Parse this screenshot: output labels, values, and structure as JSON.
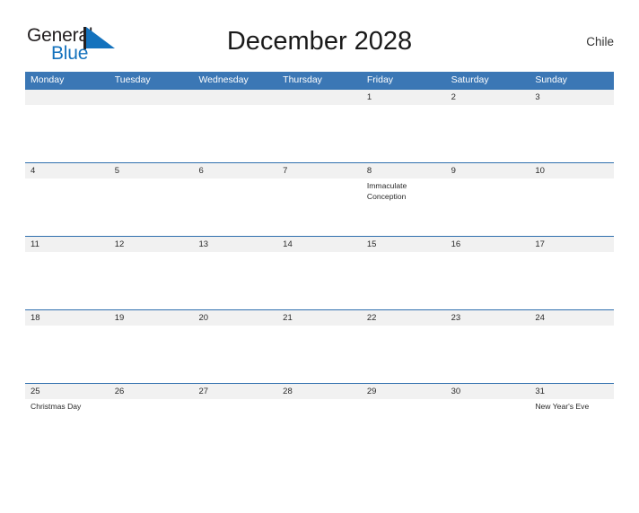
{
  "logo": {
    "text_primary": "General",
    "text_secondary": "Blue",
    "flag_icon": "triangle-flag-icon",
    "color_primary": "#231f20",
    "color_secondary": "#1472bd"
  },
  "header": {
    "title": "December 2028",
    "country": "Chile"
  },
  "theme": {
    "header_blue": "#3b77b5",
    "date_band_gray": "#f1f1f1",
    "rule_blue": "#2f6fae",
    "text_dark": "#2a2a2a",
    "background": "#ffffff"
  },
  "calendar": {
    "weekdays": [
      "Monday",
      "Tuesday",
      "Wednesday",
      "Thursday",
      "Friday",
      "Saturday",
      "Sunday"
    ],
    "weeks": [
      {
        "dates": [
          "",
          "",
          "",
          "",
          "1",
          "2",
          "3"
        ],
        "events": [
          "",
          "",
          "",
          "",
          "",
          "",
          ""
        ]
      },
      {
        "dates": [
          "4",
          "5",
          "6",
          "7",
          "8",
          "9",
          "10"
        ],
        "events": [
          "",
          "",
          "",
          "",
          "Immaculate Conception",
          "",
          ""
        ]
      },
      {
        "dates": [
          "11",
          "12",
          "13",
          "14",
          "15",
          "16",
          "17"
        ],
        "events": [
          "",
          "",
          "",
          "",
          "",
          "",
          ""
        ]
      },
      {
        "dates": [
          "18",
          "19",
          "20",
          "21",
          "22",
          "23",
          "24"
        ],
        "events": [
          "",
          "",
          "",
          "",
          "",
          "",
          ""
        ]
      },
      {
        "dates": [
          "25",
          "26",
          "27",
          "28",
          "29",
          "30",
          "31"
        ],
        "events": [
          "Christmas Day",
          "",
          "",
          "",
          "",
          "",
          "New Year's Eve"
        ]
      }
    ]
  }
}
